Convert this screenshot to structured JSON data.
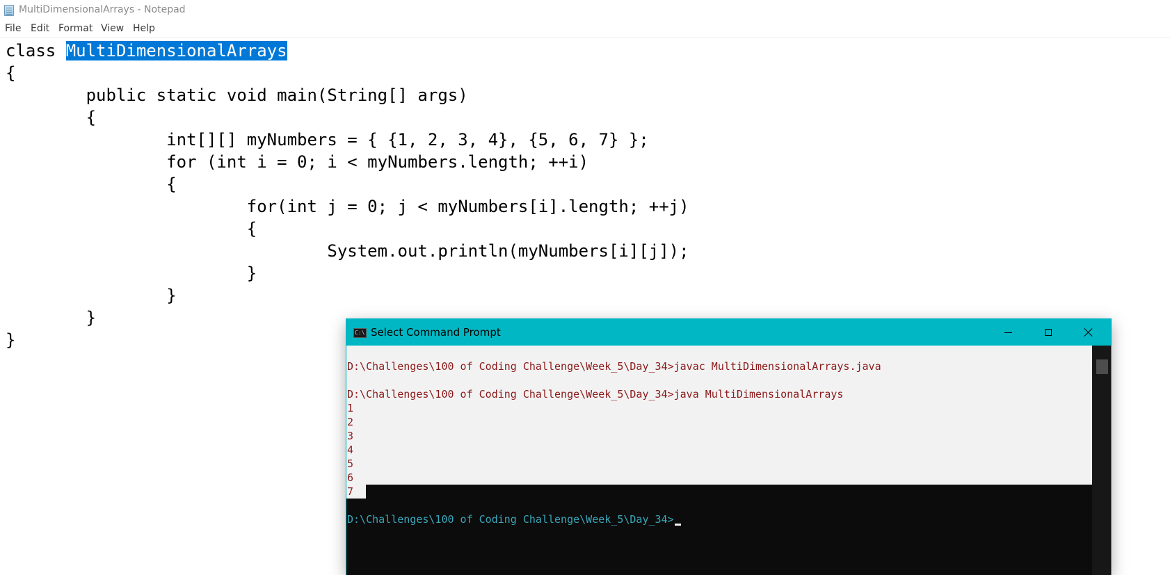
{
  "notepad": {
    "title": "MultiDimensionalArrays - Notepad",
    "menu": [
      "File",
      "Edit",
      "Format",
      "View",
      "Help"
    ],
    "code": {
      "prefix": "class ",
      "selected": "MultiDimensionalArrays",
      "rest": "\n{\n\tpublic static void main(String[] args)\n\t{\n\t\tint[][] myNumbers = { {1, 2, 3, 4}, {5, 6, 7} };\n\t\tfor (int i = 0; i < myNumbers.length; ++i)\n\t\t{\n\t\t\tfor(int j = 0; j < myNumbers[i].length; ++j)\n\t\t\t{\n\t\t\t\tSystem.out.println(myNumbers[i][j]);\n\t\t\t}\n\t\t}\n\t}\n}"
    },
    "colors": {
      "selection": "#0078d7"
    }
  },
  "cmd": {
    "title": "Select Command Prompt",
    "selected_output": "\nD:\\Challenges\\100 of Coding Challenge\\Week_5\\Day_34>javac MultiDimensionalArrays.java\n\nD:\\Challenges\\100 of Coding Challenge\\Week_5\\Day_34>java MultiDimensionalArrays\n1\n2\n3\n4\n5\n6\n7",
    "prompt": "D:\\Challenges\\100 of Coding Challenge\\Week_5\\Day_34>",
    "icon_text": "C:\\",
    "colors": {
      "titlebar": "#00b7c3",
      "selection_bg": "#f2f2f2",
      "selection_text": "#8b1a1a",
      "prompt": "#3aa6b9"
    }
  }
}
